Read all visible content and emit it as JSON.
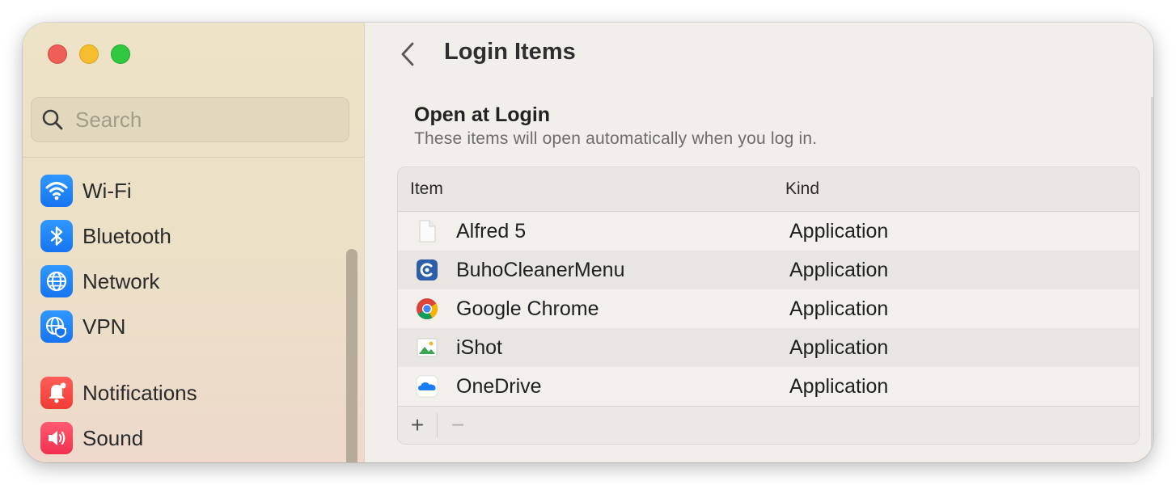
{
  "window": {
    "traffic_lights": {
      "close": "#ed5f57",
      "minimize": "#f5bd30",
      "zoom": "#2fc840"
    }
  },
  "sidebar": {
    "search": {
      "placeholder": "Search",
      "value": "",
      "icon": "magnifier-icon"
    },
    "items": [
      {
        "label": "Wi-Fi",
        "icon": "wifi-icon"
      },
      {
        "label": "Bluetooth",
        "icon": "bluetooth-icon"
      },
      {
        "label": "Network",
        "icon": "globe-icon"
      },
      {
        "label": "VPN",
        "icon": "vpn-globe-shield-icon"
      },
      {
        "label": "Notifications",
        "icon": "bell-icon"
      },
      {
        "label": "Sound",
        "icon": "speaker-icon"
      }
    ]
  },
  "main": {
    "title": "Login Items",
    "back_icon": "chevron-left-icon",
    "section": {
      "title": "Open at Login",
      "subtitle": "These items will open automatically when you log in."
    },
    "table": {
      "columns": [
        "Item",
        "Kind"
      ],
      "rows": [
        {
          "name": "Alfred 5",
          "kind": "Application",
          "icon": "blank-document-icon"
        },
        {
          "name": "BuhoCleanerMenu",
          "kind": "Application",
          "icon": "buhocleaner-icon"
        },
        {
          "name": "Google Chrome",
          "kind": "Application",
          "icon": "chrome-icon"
        },
        {
          "name": "iShot",
          "kind": "Application",
          "icon": "image-icon"
        },
        {
          "name": "OneDrive",
          "kind": "Application",
          "icon": "cloud-icon"
        }
      ],
      "add_label": "+",
      "remove_label": "−"
    }
  },
  "colors": {
    "accent_blue": "#1a7cf5",
    "sidebar_bg": "#ede3c6",
    "content_bg": "#f2eeea"
  }
}
